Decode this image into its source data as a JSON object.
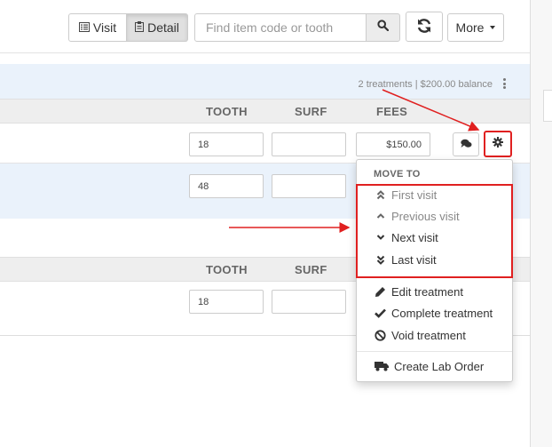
{
  "toolbar": {
    "visit_label": "Visit",
    "detail_label": "Detail",
    "search_placeholder": "Find item code or tooth",
    "more_label": "More"
  },
  "visit_summary": "2 treatments | $200.00 balance",
  "columns": {
    "tooth": "TOOTH",
    "surf": "SURF",
    "fees": "FEES"
  },
  "treatments_visit1": [
    {
      "tooth": "18",
      "surf": "",
      "fee": "$150.00"
    },
    {
      "tooth": "48",
      "surf": "",
      "fee": ""
    }
  ],
  "treatments_visit2": [
    {
      "tooth": "18",
      "surf": ""
    }
  ],
  "menu": {
    "move_to_header": "MOVE TO",
    "move_items": [
      "First visit",
      "Previous visit",
      "Next visit",
      "Last visit"
    ],
    "actions": [
      "Edit treatment",
      "Complete treatment",
      "Void treatment"
    ],
    "lab_order": "Create Lab Order"
  },
  "colors": {
    "annotation_red": "#e02020",
    "section_blue": "#eaf2fb"
  },
  "icons": [
    "list-icon",
    "clipboard-icon",
    "search-icon",
    "refresh-icon",
    "comments-icon",
    "gear-icon",
    "double-chevron-up-icon",
    "chevron-up-icon",
    "chevron-down-icon",
    "double-chevron-down-icon",
    "pencil-icon",
    "check-icon",
    "ban-icon",
    "truck-icon",
    "kebab-icon"
  ]
}
